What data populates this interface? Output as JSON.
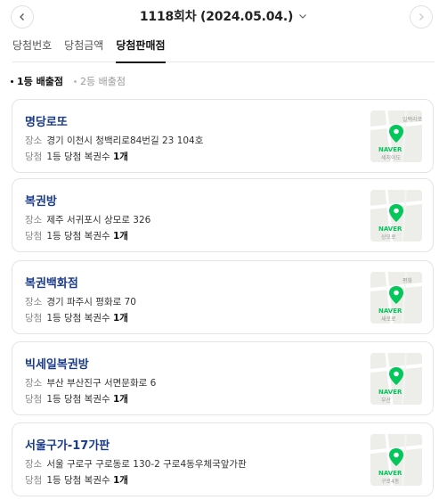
{
  "header": {
    "title": "1118회차 (2024.05.04.)",
    "prev_icon": "chevron-left-icon",
    "next_icon": "chevron-right-icon",
    "dropdown_icon": "chevron-down-icon"
  },
  "tabs": [
    {
      "label": "당첨번호",
      "active": false
    },
    {
      "label": "당첨금액",
      "active": false
    },
    {
      "label": "당첨판매점",
      "active": true
    }
  ],
  "subtabs": [
    {
      "label": "1등 배출점",
      "active": true
    },
    {
      "label": "2등 배출점",
      "active": false
    }
  ],
  "stores": [
    {
      "name": "명당로또",
      "address_label": "장소",
      "address": "경기 이천시 청백리로84번길 23 104호",
      "win_label": "당첨",
      "win_text": "1등 당첨 복권수",
      "win_count": "1개",
      "map_text_top": "일백리로",
      "map_text_bottom": "세지이도"
    },
    {
      "name": "복권방",
      "address_label": "장소",
      "address": "제주 서귀포시 상모로 326",
      "win_label": "당첨",
      "win_text": "1등 당첨 복권수",
      "win_count": "1개",
      "map_text_top": "",
      "map_text_bottom": "상모로"
    },
    {
      "name": "복권백화점",
      "address_label": "장소",
      "address": "경기 파주시 평화로 70",
      "win_label": "당첨",
      "win_text": "1등 당첨 복권수",
      "win_count": "1개",
      "map_text_top": "평화",
      "map_text_bottom": "새로로"
    },
    {
      "name": "빅세일복권방",
      "address_label": "장소",
      "address": "부산 부산진구 서면문화로 6",
      "win_label": "당첨",
      "win_text": "1등 당첨 복권수",
      "win_count": "1개",
      "map_text_top": "",
      "map_text_bottom": "부산"
    },
    {
      "name": "서울구가-17가판",
      "address_label": "장소",
      "address": "서울 구로구 구로동로 130-2 구로4동우체국앞가판",
      "win_label": "당첨",
      "win_text": "1등 당첨 복권수",
      "win_count": "1개",
      "map_text_top": "",
      "map_text_bottom": "구로4동"
    }
  ],
  "map_brand": "NAVER",
  "colors": {
    "store_name": "#1a3a8a",
    "naver_green": "#03c75a"
  }
}
